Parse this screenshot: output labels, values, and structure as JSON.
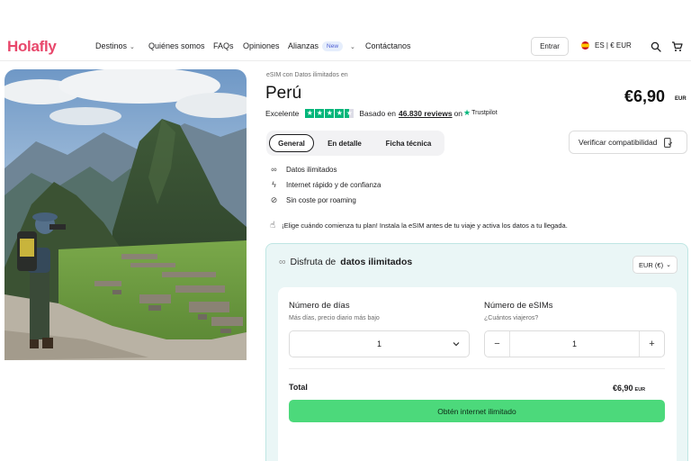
{
  "header": {
    "logo": "Holafly",
    "nav": [
      {
        "label": "Destinos",
        "has_chevron": true
      },
      {
        "label": "Quiénes somos"
      },
      {
        "label": "FAQs"
      },
      {
        "label": "Opiniones"
      },
      {
        "label": "Alianzas",
        "badge": "New",
        "has_chevron": true
      },
      {
        "label": "Contáctanos"
      }
    ],
    "login_label": "Entrar",
    "language_currency": "ES | € EUR"
  },
  "product": {
    "eyebrow": "eSIM con Datos ilimitados en",
    "country": "Perú",
    "price": "€6,90",
    "price_currency": "EUR",
    "rating_label": "Excelente",
    "rating_stars": 4.5,
    "reviews_prefix": "Basado en",
    "reviews_count": "46.830 reviews",
    "reviews_on": "on",
    "reviews_source": "Trustpilot"
  },
  "tabs": [
    {
      "label": "General",
      "active": true
    },
    {
      "label": "En detalle",
      "active": false
    },
    {
      "label": "Ficha técnica",
      "active": false
    }
  ],
  "verify_label": "Verificar compatibilidad",
  "features": [
    {
      "icon": "infinity-icon",
      "label": "Datos ilimitados"
    },
    {
      "icon": "lightning-icon",
      "label": "Internet rápido y de confianza"
    },
    {
      "icon": "no-roaming-icon",
      "label": "Sin coste por roaming"
    }
  ],
  "notice": "¡Elige cuándo comienza tu plan! Instala la eSIM antes de tu viaje y activa los datos a tu llegada.",
  "plan_card": {
    "title_prefix": "Disfruta de",
    "title_bold": "datos ilimitados",
    "currency_select": "EUR (€)",
    "days": {
      "label": "Número de días",
      "hint": "Más días, precio diario más bajo",
      "value": "1"
    },
    "esims": {
      "label": "Número de eSIMs",
      "hint": "¿Cuántos viajeros?",
      "value": "1",
      "minus": "−",
      "plus": "+"
    },
    "total_label": "Total",
    "total_value": "€6,90",
    "total_currency": "EUR",
    "cta_label": "Obtén internet ilimitado"
  },
  "colors": {
    "brand": "#e8476b",
    "cta": "#4cd97b",
    "trustpilot": "#00b67a",
    "card_bg": "#eaf6f6"
  }
}
